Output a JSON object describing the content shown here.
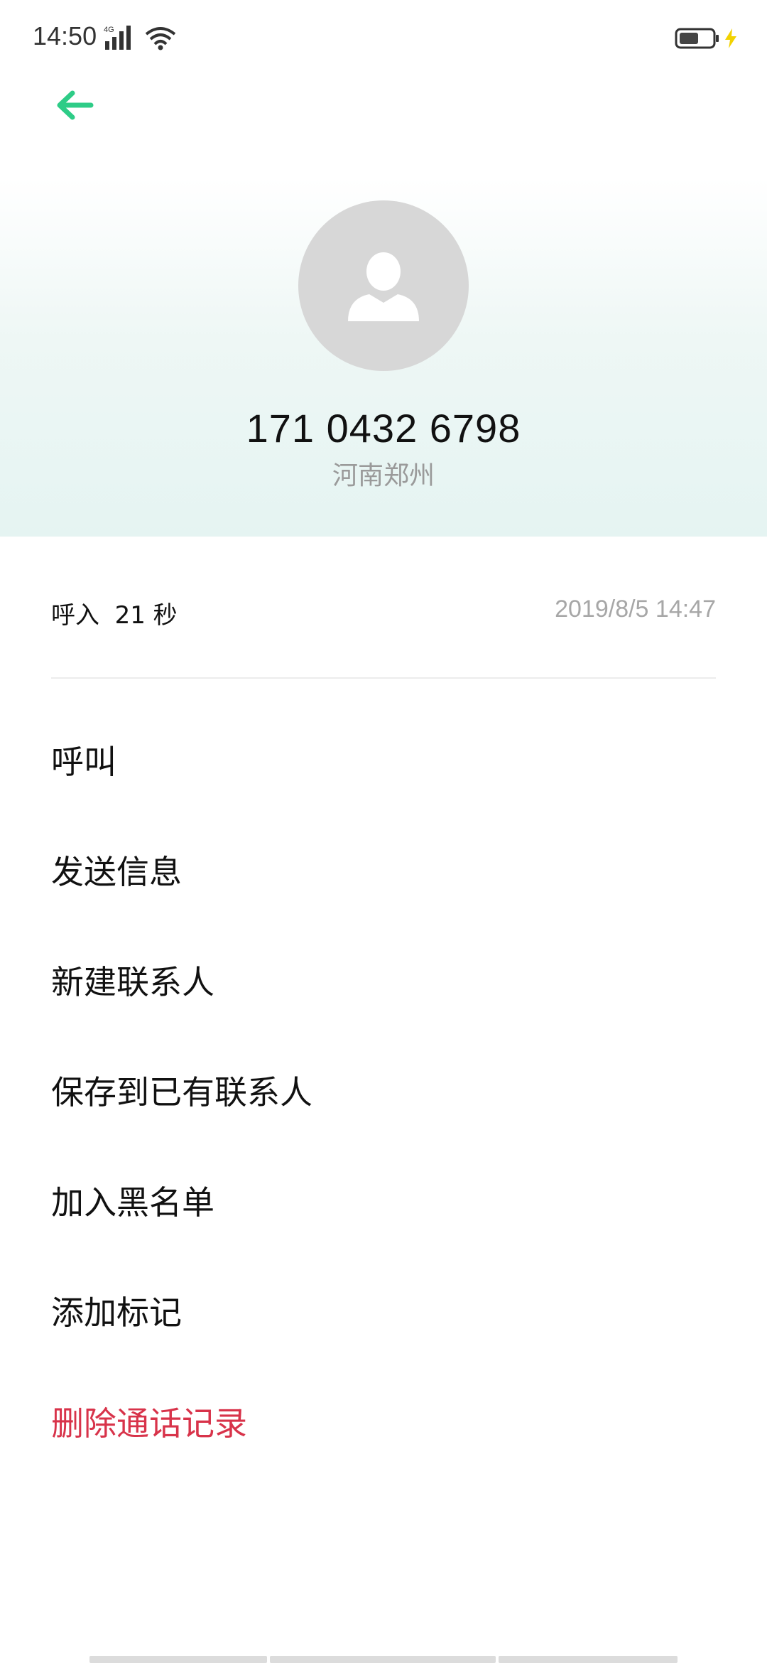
{
  "status_bar": {
    "time": "14:50",
    "network_label": "4G",
    "icons": [
      "signal-icon",
      "wifi-icon",
      "battery-icon",
      "charging-icon"
    ]
  },
  "header": {
    "back_icon": "arrow-left-icon",
    "avatar_icon": "person-silhouette-icon",
    "phone_number": "171 0432 6798",
    "location": "河南郑州"
  },
  "call_info": {
    "type_and_duration": "呼入  21 秒",
    "datetime": "2019/8/5 14:47"
  },
  "actions": [
    {
      "label": "呼叫"
    },
    {
      "label": "发送信息"
    },
    {
      "label": "新建联系人"
    },
    {
      "label": "保存到已有联系人"
    },
    {
      "label": "加入黑名单"
    },
    {
      "label": "添加标记"
    },
    {
      "label": "删除通话记录"
    }
  ],
  "colors": {
    "accent": "#2ecc87",
    "danger": "#d8334a",
    "avatar_bg": "#d7d7d7"
  }
}
